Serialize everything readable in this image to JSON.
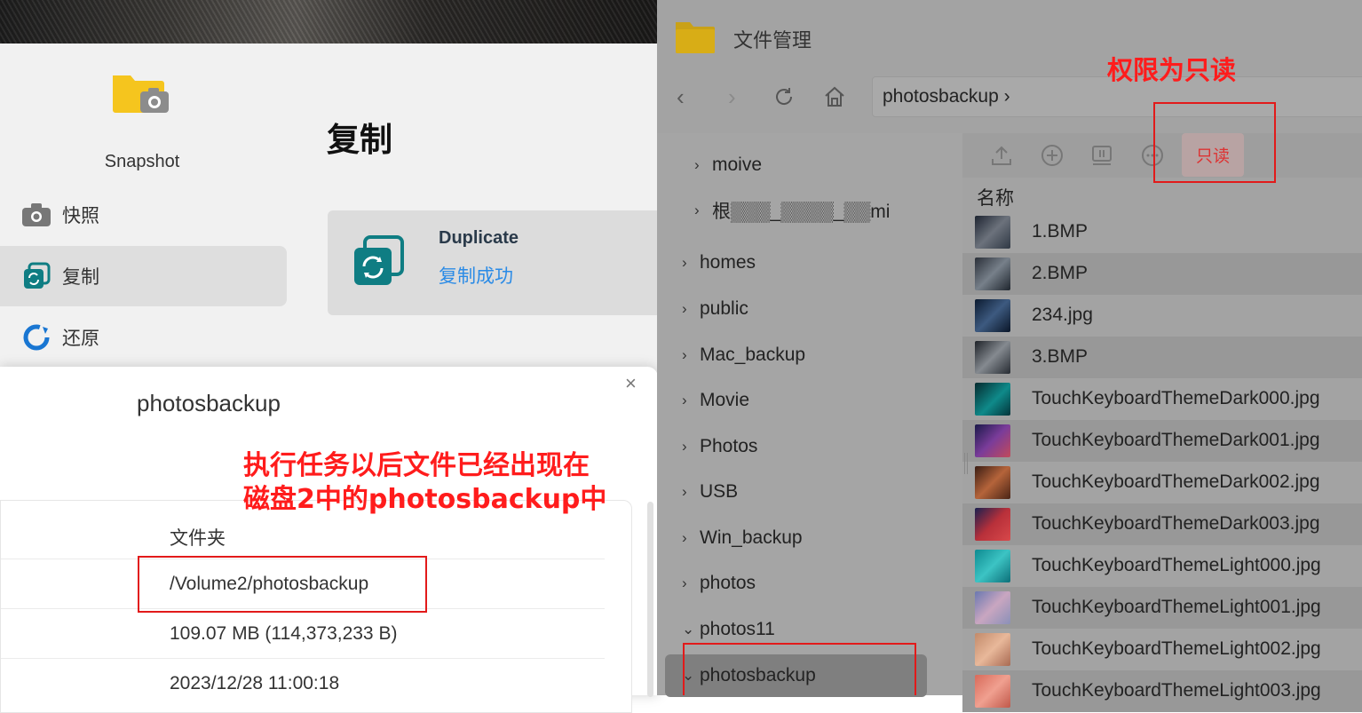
{
  "snapshot_app": {
    "title": "Snapshot",
    "menu": [
      {
        "label": "快照",
        "icon": "camera-icon"
      },
      {
        "label": "复制",
        "icon": "replicate-icon",
        "active": true
      },
      {
        "label": "还原",
        "icon": "restore-icon"
      }
    ],
    "main_title": "复制",
    "task_card": {
      "name": "Duplicate",
      "status": "复制成功"
    }
  },
  "dialog": {
    "title": "photosbackup",
    "rows": [
      {
        "value": "文件夹"
      },
      {
        "value": "/Volume2/photosbackup"
      },
      {
        "value": "109.07 MB (114,373,233 B)"
      },
      {
        "value": "2023/12/28 11:00:18"
      }
    ]
  },
  "file_manager": {
    "title": "文件管理",
    "address": "photosbackup",
    "readonly_label": "只读",
    "column_name": "名称",
    "tree": [
      "moive",
      "根▒▒▒_▒▒▒▒_▒▒mi",
      "homes",
      "public",
      "Mac_backup",
      "Movie",
      "Photos",
      "USB",
      "Win_backup",
      "photos",
      "photos11",
      "photosbackup"
    ],
    "files": [
      "1.BMP",
      "2.BMP",
      "234.jpg",
      "3.BMP",
      "TouchKeyboardThemeDark000.jpg",
      "TouchKeyboardThemeDark001.jpg",
      "TouchKeyboardThemeDark002.jpg",
      "TouchKeyboardThemeDark003.jpg",
      "TouchKeyboardThemeLight000.jpg",
      "TouchKeyboardThemeLight001.jpg",
      "TouchKeyboardThemeLight002.jpg",
      "TouchKeyboardThemeLight003.jpg"
    ]
  },
  "annotations": {
    "readonly_note": "权限为只读",
    "task_note_line1": "执行任务以后文件已经出现在",
    "task_note_line2": "磁盘2中的photosbackup中"
  },
  "colors": {
    "annotation_red": "#ff1c1c",
    "link_blue": "#2b8be6",
    "folder_yellow": "#f5c51e",
    "teal_icon": "#0f7d83"
  }
}
